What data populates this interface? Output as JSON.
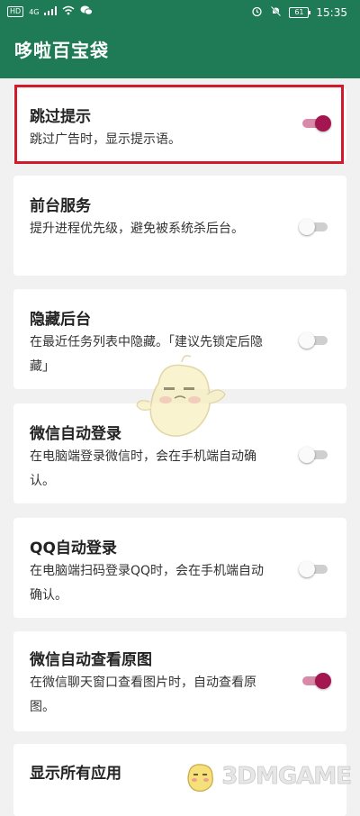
{
  "status_bar": {
    "left_badges": [
      "HD",
      "4G"
    ],
    "battery": "61",
    "time": "15:35"
  },
  "app": {
    "title": "哆啦百宝袋"
  },
  "settings": [
    {
      "title": "跳过提示",
      "description": "跳过广告时，显示提示语。",
      "enabled": true
    },
    {
      "title": "前台服务",
      "description": "提升进程优先级，避免被系统杀后台。",
      "enabled": false
    },
    {
      "title": "隐藏后台",
      "description": "在最近任务列表中隐藏。「建议先锁定后隐藏」",
      "enabled": false
    },
    {
      "title": "微信自动登录",
      "description": "在电脑端登录微信时，会在手机端自动确认。",
      "enabled": false
    },
    {
      "title": "QQ自动登录",
      "description": "在电脑端扫码登录QQ时，会在手机端自动确认。",
      "enabled": false
    },
    {
      "title": "微信自动查看原图",
      "description": "在微信聊天窗口查看图片时，自动查看原图。",
      "enabled": true
    },
    {
      "title": "显示所有应用",
      "description": "",
      "enabled": false
    }
  ],
  "watermark": {
    "text": "3DMGAME"
  },
  "colors": {
    "appbar": "#1f7a56",
    "toggle_on": "#a3164f",
    "highlight": "#d21b2a"
  }
}
